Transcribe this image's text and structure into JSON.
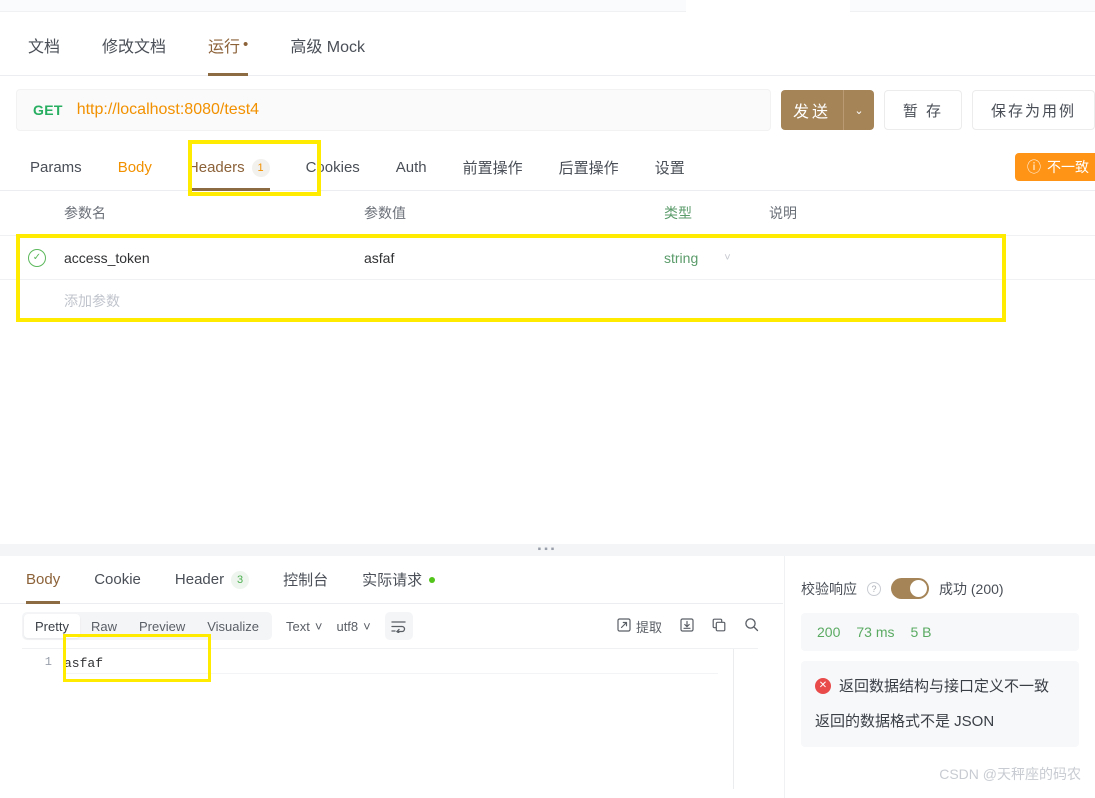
{
  "main_tabs": [
    {
      "label": "文档",
      "active": false,
      "mark": ""
    },
    {
      "label": "修改文档",
      "active": false,
      "mark": ""
    },
    {
      "label": "运行",
      "active": true,
      "mark": "•"
    },
    {
      "label": "高级 Mock",
      "active": false,
      "mark": ""
    }
  ],
  "url_row": {
    "method": "GET",
    "url": "http://localhost:8080/test4",
    "send_label": "发送",
    "send_caret": "⌄",
    "temp_save_label": "暂 存",
    "save_case_label": "保存为用例"
  },
  "sub_tabs": [
    {
      "label": "Params",
      "badge": "",
      "state": "normal"
    },
    {
      "label": "Body",
      "badge": "",
      "state": "orange"
    },
    {
      "label": "Headers",
      "badge": "1",
      "state": "active"
    },
    {
      "label": "Cookies",
      "badge": "",
      "state": "normal"
    },
    {
      "label": "Auth",
      "badge": "",
      "state": "normal"
    },
    {
      "label": "前置操作",
      "badge": "",
      "state": "normal"
    },
    {
      "label": "后置操作",
      "badge": "",
      "state": "normal"
    },
    {
      "label": "设置",
      "badge": "",
      "state": "normal"
    }
  ],
  "inconsistent_badge": {
    "icon": "info-icon",
    "label": "不一致"
  },
  "params_table": {
    "headers": [
      "参数名",
      "参数值",
      "类型",
      "说明"
    ],
    "rows": [
      {
        "enabled": true,
        "name": "access_token",
        "value": "asfaf",
        "type": "string",
        "desc": ""
      }
    ],
    "add_placeholder": "添加参数"
  },
  "response_tabs": [
    {
      "label": "Body",
      "badge": "",
      "dot": false,
      "active": true
    },
    {
      "label": "Cookie",
      "badge": "",
      "dot": false,
      "active": false
    },
    {
      "label": "Header",
      "badge": "3",
      "dot": false,
      "active": false
    },
    {
      "label": "控制台",
      "badge": "",
      "dot": false,
      "active": false
    },
    {
      "label": "实际请求",
      "badge": "",
      "dot": true,
      "active": false
    }
  ],
  "response_toolbar": {
    "view_modes": [
      {
        "label": "Pretty",
        "on": true
      },
      {
        "label": "Raw",
        "on": false
      },
      {
        "label": "Preview",
        "on": false
      },
      {
        "label": "Visualize",
        "on": false
      }
    ],
    "format_select": "Text",
    "encoding_select": "utf8",
    "wrap_icon": "word-wrap-icon",
    "extract_label": "提取",
    "extract_icon": "extract-icon",
    "download_icon": "download-icon",
    "copy_icon": "copy-icon",
    "search_icon": "search-icon"
  },
  "response_body": {
    "lines": [
      {
        "no": "1",
        "text": "asfaf"
      }
    ]
  },
  "verify_panel": {
    "label": "校验响应",
    "help_icon": "question-icon",
    "toggle_on": true,
    "status": "成功 (200)",
    "stats": [
      "200",
      "73 ms",
      "5 B"
    ],
    "error_icon": "error-icon",
    "error_title": "返回数据结构与接口定义不一致",
    "error_detail": "返回的数据格式不是 JSON"
  },
  "watermark": "CSDN @天秤座的码农",
  "colors": {
    "accent_brown": "#a58458",
    "method_green": "#27ae60",
    "url_orange": "#f29100",
    "warning_orange": "#ff9416",
    "error_red": "#e94b4b",
    "annotation_yellow": "#ffeb00",
    "success_green": "#5aaa62"
  }
}
